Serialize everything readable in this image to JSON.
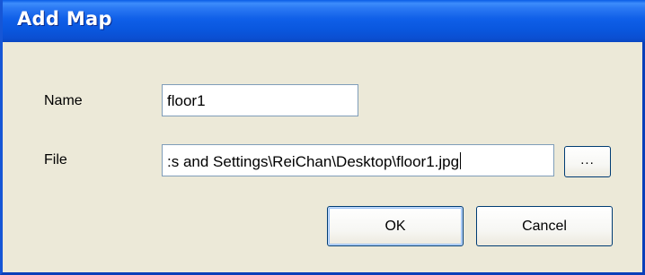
{
  "window": {
    "title": "Add Map"
  },
  "form": {
    "name_label": "Name",
    "name_value": "floor1",
    "file_label": "File",
    "file_value": ":s and Settings\\ReiChan\\Desktop\\floor1.jpg",
    "browse_label": "..."
  },
  "buttons": {
    "ok_label": "OK",
    "cancel_label": "Cancel"
  },
  "colors": {
    "titlebar_blue": "#0a57de",
    "dialog_face": "#ece9d8",
    "textbox_border": "#7f9db9",
    "button_border": "#003c74"
  }
}
